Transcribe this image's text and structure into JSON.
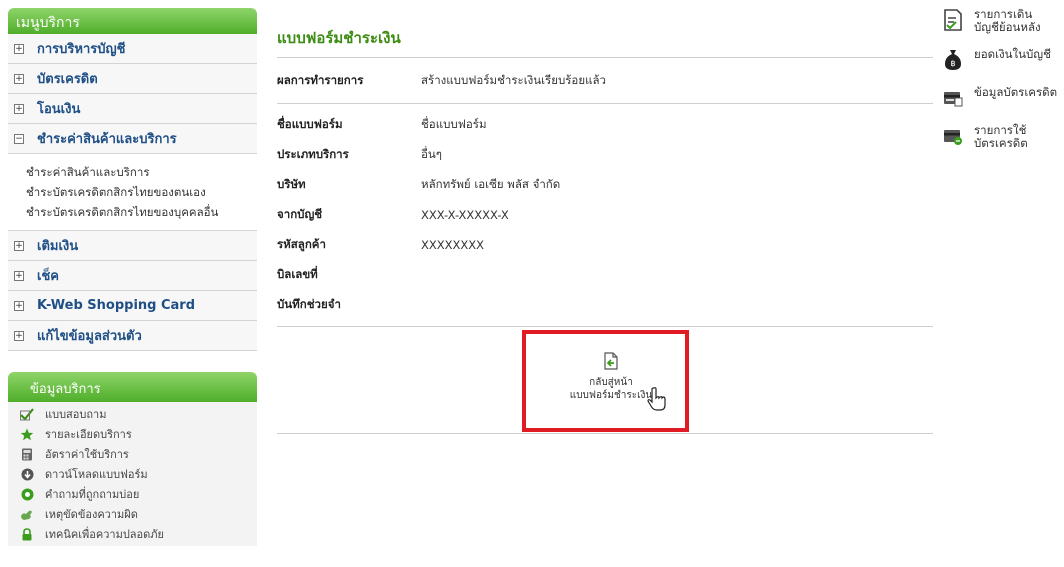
{
  "sidebar": {
    "menu_title": "เมนูบริการ",
    "items": [
      {
        "label": "การบริหารบัญชี",
        "box": "+"
      },
      {
        "label": "บัตรเครดิต",
        "box": "+"
      },
      {
        "label": "โอนเงิน",
        "box": "+"
      },
      {
        "label": "ชำระค่าสินค้าและบริการ",
        "box": "−"
      }
    ],
    "submenu": [
      "ชำระค่าสินค้าและบริการ",
      "ชำระบัตรเครดิตกสิกรไทยของตนเอง",
      "ชำระบัตรเครดิตกสิกรไทยของบุคคลอื่น"
    ],
    "items_after": [
      {
        "label": "เติมเงิน",
        "box": "+"
      },
      {
        "label": "เช็ค",
        "box": "+"
      },
      {
        "label": "K-Web Shopping Card",
        "box": "+"
      },
      {
        "label": "แก้ไขข้อมูลส่วนตัว",
        "box": "+"
      }
    ],
    "info_title": "ข้อมูลบริการ",
    "info_items": [
      {
        "label": "แบบสอบถาม",
        "icon": "check-icon"
      },
      {
        "label": "รายละเอียดบริการ",
        "icon": "star-icon"
      },
      {
        "label": "อัตราค่าใช้บริการ",
        "icon": "calculator-icon"
      },
      {
        "label": "ดาวน์โหลดแบบฟอร์ม",
        "icon": "download-icon"
      },
      {
        "label": "คำถามที่ถูกถามบ่อย",
        "icon": "faq-icon"
      },
      {
        "label": "เหตุขัดข้องความผิด",
        "icon": "hand-icon"
      },
      {
        "label": "เทคนิคเพื่อความปลอดภัย",
        "icon": "lock-icon"
      }
    ]
  },
  "main": {
    "title": "แบบฟอร์มชำระเงิน",
    "result_label": "ผลการทำรายการ",
    "result_value": "สร้างแบบฟอร์มชำระเงินเรียบร้อยแล้ว",
    "fields": [
      {
        "label": "ชื่อแบบฟอร์ม",
        "value": "ชื่อแบบฟอร์ม"
      },
      {
        "label": "ประเภทบริการ",
        "value": "อื่นๆ"
      },
      {
        "label": "บริษัท",
        "value": "หลักทรัพย์ เอเซีย พลัส จำกัด"
      },
      {
        "label": "จากบัญชี",
        "value": "XXX-X-XXXXX-X"
      },
      {
        "label": "รหัสลูกค้า",
        "value": "XXXXXXXX"
      },
      {
        "label": "บิลเลขที่",
        "value": ""
      },
      {
        "label": "บันทึกช่วยจำ",
        "value": ""
      }
    ],
    "back_line1": "กลับสู่หน้า",
    "back_line2": "แบบฟอร์มชำระเงิน"
  },
  "right_menu": [
    {
      "line1": "รายการเดิน",
      "line2": "บัญชีย้อนหลัง",
      "icon": "statement-icon"
    },
    {
      "line1": "ยอดเงินในบัญชี",
      "line2": "",
      "icon": "money-bag-icon"
    },
    {
      "line1": "ข้อมูลบัตรเครดิต",
      "line2": "",
      "icon": "credit-card-icon"
    },
    {
      "line1": "รายการใช้",
      "line2": "บัตรเครดิต",
      "icon": "card-usage-icon"
    }
  ],
  "colors": {
    "accent_green": "#4fae2a",
    "title_green": "#3d8c14",
    "link_blue": "#1f4f86",
    "highlight_red": "#e01b24"
  }
}
